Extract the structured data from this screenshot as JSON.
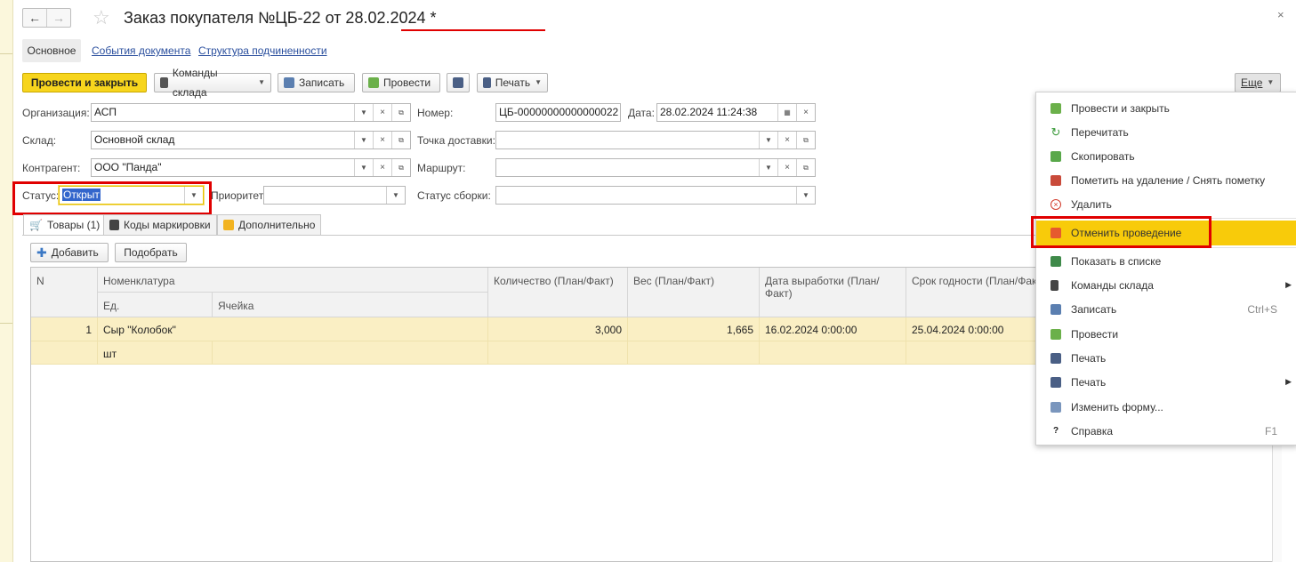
{
  "window": {
    "title": "Заказ покупателя №ЦБ-22 от 28.02.2024",
    "modified_mark": "*"
  },
  "nav": {
    "back": "←",
    "forward": "→",
    "star": "☆",
    "close": "×"
  },
  "tabs": [
    "Основное",
    "События документа",
    "Структура подчиненности"
  ],
  "toolbar": {
    "post_close": "Провести и закрыть",
    "warehouse_cmds": "Команды склада",
    "save": "Записать",
    "post": "Провести",
    "print": "Печать",
    "more": "Еще"
  },
  "form": {
    "org_label": "Организация:",
    "org_value": "АСП",
    "num_label": "Номер:",
    "num_value": "ЦБ-00000000000000022",
    "date_label": "Дата:",
    "date_value": "28.02.2024 11:24:38",
    "warehouse_label": "Склад:",
    "warehouse_value": "Основной склад",
    "delivery_label": "Точка доставки:",
    "delivery_value": "",
    "contractor_label": "Контрагент:",
    "contractor_value": "ООО \"Панда\"",
    "route_label": "Маршрут:",
    "route_value": "",
    "status_label": "Статус:",
    "status_value": "Открыт",
    "priority_label": "Приоритет:",
    "priority_value": "",
    "assembly_label": "Статус сборки:",
    "assembly_value": ""
  },
  "subtabs": [
    "Товары (1)",
    "Коды маркировки",
    "Дополнительно"
  ],
  "table_toolbar": {
    "add": "Добавить",
    "pick": "Подобрать"
  },
  "table": {
    "headers": {
      "n": "N",
      "nomenclature": "Номенклатура",
      "unit": "Ед.",
      "cell": "Ячейка",
      "qty": "Количество (План/Факт)",
      "weight": "Вес (План/Факт)",
      "prod_date": "Дата выработки (План/Факт)",
      "expiry": "Срок годности (План/Факт)"
    },
    "rows": [
      {
        "n": "1",
        "nomenclature": "Сыр \"Колобок\"",
        "unit": "шт",
        "cell": "",
        "qty": "3,000",
        "weight": "1,665",
        "prod_date": "16.02.2024 0:00:00",
        "expiry": "25.04.2024 0:00:00"
      }
    ]
  },
  "menu": {
    "items": [
      {
        "label": "Провести и закрыть",
        "icon": "post-close-icon",
        "shortcut": ""
      },
      {
        "label": "Перечитать",
        "icon": "reload-icon",
        "shortcut": ""
      },
      {
        "label": "Скопировать",
        "icon": "copy-icon",
        "shortcut": ""
      },
      {
        "label": "Пометить на удаление / Снять пометку",
        "icon": "mark-delete-icon",
        "shortcut": ""
      },
      {
        "label": "Удалить",
        "icon": "delete-icon",
        "shortcut": ""
      },
      {
        "label": "Отменить проведение",
        "icon": "unpost-icon",
        "shortcut": ""
      },
      {
        "label": "Показать в списке",
        "icon": "show-list-icon",
        "shortcut": ""
      },
      {
        "label": "Команды склада",
        "icon": "warehouse-icon",
        "shortcut": ""
      },
      {
        "label": "Записать",
        "icon": "save-icon",
        "shortcut": "Ctrl+S"
      },
      {
        "label": "Провести",
        "icon": "post-icon",
        "shortcut": ""
      },
      {
        "label": "Печать",
        "icon": "print-icon",
        "shortcut": ""
      },
      {
        "label": "Печать",
        "icon": "print-icon",
        "shortcut": ""
      },
      {
        "label": "Изменить форму...",
        "icon": "form-icon",
        "shortcut": ""
      },
      {
        "label": "Справка",
        "icon": "help-icon",
        "shortcut": "F1"
      }
    ]
  },
  "colors": {
    "accent_yellow": "#f7d51d",
    "highlight_row": "#faefc4",
    "annotation_red": "#e00000",
    "menu_highlight": "#f8cb0a"
  }
}
